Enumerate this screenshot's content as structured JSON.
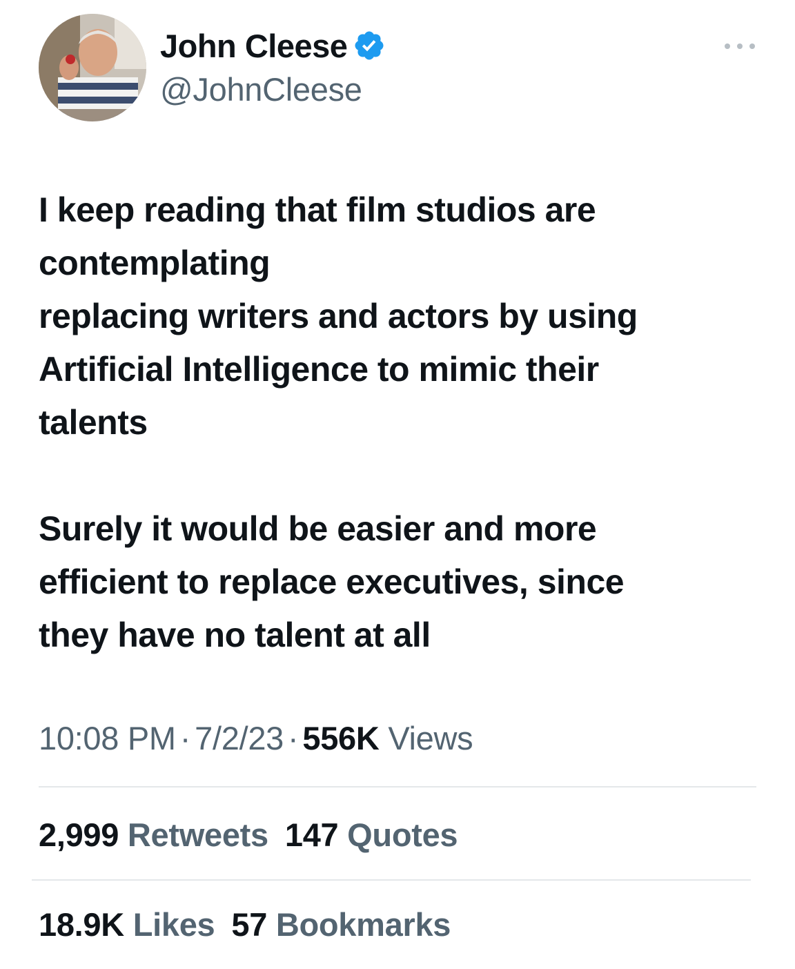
{
  "author": {
    "name": "John Cleese",
    "handle": "@JohnCleese",
    "verified": true
  },
  "colors": {
    "primary_text": "#0f1419",
    "secondary_text": "#536471",
    "verified_blue": "#1d9bf0",
    "divider": "#e4e7ea"
  },
  "icons": {
    "verified": "verified-badge-icon",
    "more": "more-options-icon"
  },
  "tweet": {
    "lines_p1": [
      "I keep reading that film studios are",
      "contemplating",
      "replacing writers and actors by using",
      "Artificial Intelligence to mimic their",
      "talents"
    ],
    "lines_p2": [
      "Surely it would be easier and more",
      "efficient to replace executives, since",
      "they have no talent at all"
    ]
  },
  "meta": {
    "time": "10:08 PM",
    "date": "7/2/23",
    "separator": "·",
    "views_count": "556K",
    "views_label": "Views"
  },
  "stats": {
    "retweets_count": "2,999",
    "retweets_label": "Retweets",
    "quotes_count": "147",
    "quotes_label": "Quotes",
    "likes_count": "18.9K",
    "likes_label": "Likes",
    "bookmarks_count": "57",
    "bookmarks_label": "Bookmarks"
  }
}
